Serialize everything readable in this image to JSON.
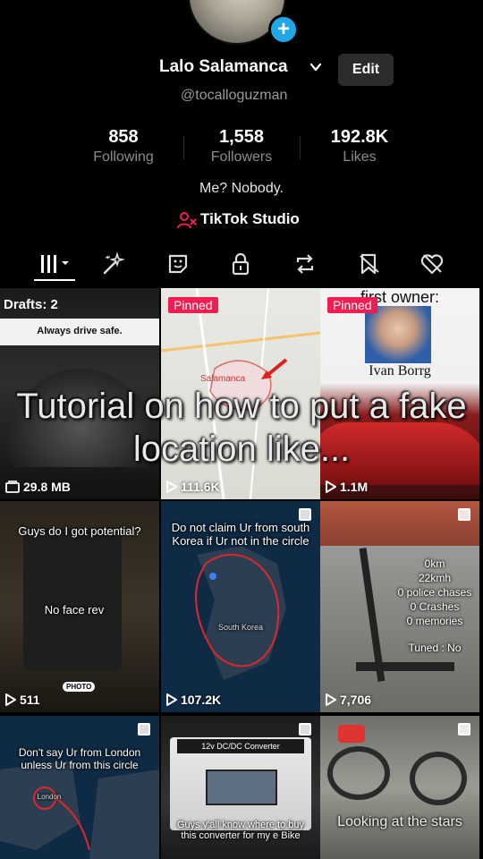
{
  "profile": {
    "name": "Lalo Salamanca",
    "edit_label": "Edit",
    "handle": "@tocalloguzman",
    "stats": [
      {
        "value": "858",
        "label": "Following"
      },
      {
        "value": "1,558",
        "label": "Followers"
      },
      {
        "value": "192.8K",
        "label": "Likes"
      }
    ],
    "bio": "Me? Nobody.",
    "studio_label": "TikTok Studio"
  },
  "colors": {
    "accent": "#ee1d52",
    "add_badge": "#20a7e6",
    "edit_bg": "#2c2c2c"
  },
  "tabs": [
    {
      "name": "tab-videos",
      "icon": "grid-bars-icon"
    },
    {
      "name": "tab-effects",
      "icon": "sparkle-wand-icon"
    },
    {
      "name": "tab-stickers",
      "icon": "sticker-icon"
    },
    {
      "name": "tab-private",
      "icon": "lock-icon"
    },
    {
      "name": "tab-reposts",
      "icon": "repost-icon"
    },
    {
      "name": "tab-favorites",
      "icon": "bookmark-icon"
    },
    {
      "name": "tab-liked",
      "icon": "heart-off-icon"
    }
  ],
  "caption_overlay": "Tutorial on how to put a fake location like...",
  "grid": {
    "cells": [
      {
        "badge": "Drafts: 2",
        "text_top": "Always drive safe.",
        "stat": "29.8 MB",
        "stat_icon": "drafts-icon"
      },
      {
        "badge": "Pinned",
        "map_label": "Salamanca",
        "stat": "111.6K",
        "stat_icon": "play-icon"
      },
      {
        "badge": "Pinned",
        "text_top": "first owner:",
        "text_mid": "Ivan Borrg",
        "stat": "1.1M",
        "stat_icon": "play-icon"
      },
      {
        "text_top": "Guys do I got potential?",
        "text_mid": "No face rev",
        "stat": "511",
        "stat_icon": "play-icon",
        "photo_label": "PHOTO"
      },
      {
        "text_top": "Do not claim Ur from south Korea if Ur not in the circle",
        "map_label": "South Korea",
        "stat": "107.2K",
        "stat_icon": "play-icon"
      },
      {
        "text_lines": [
          "0km",
          "22kmh",
          "0 police chases",
          "0 Crashes",
          "0 memories",
          "Tuned : No"
        ],
        "stat": "7,706",
        "stat_icon": "play-icon"
      },
      {
        "text_top": "Don't say Ur from London unless Ur from this circle",
        "map_label": "London"
      },
      {
        "text_top": "12v DC/DC Converter",
        "text_bottom": "Guys y'all know where to buy this converter for my e Bike"
      },
      {
        "text_bottom": "Looking at the stars"
      }
    ]
  }
}
